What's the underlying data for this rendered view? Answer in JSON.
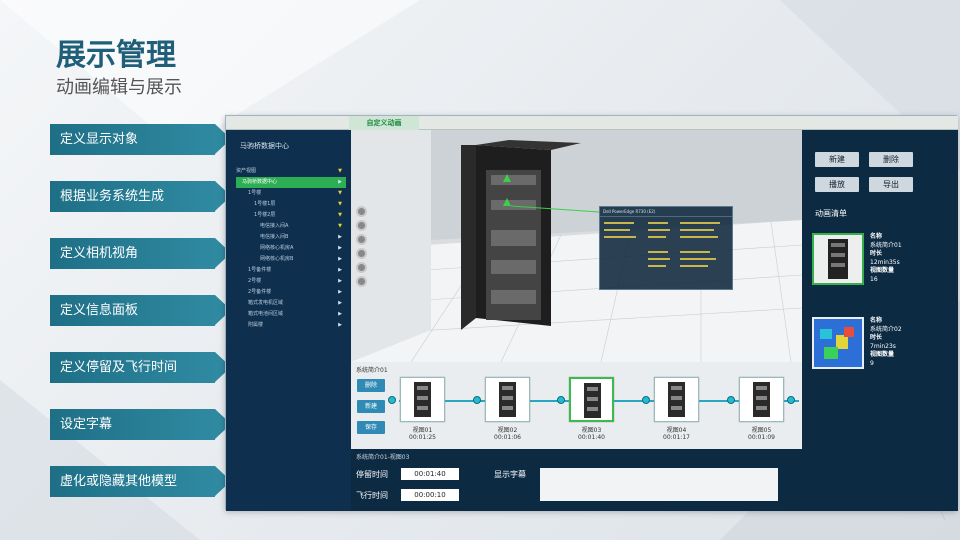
{
  "page": {
    "title": "展示管理",
    "subtitle": "动画编辑与展示"
  },
  "steps": [
    {
      "label": "定义显示对象"
    },
    {
      "label": "根据业务系统生成"
    },
    {
      "label": "定义相机视角"
    },
    {
      "label": "定义信息面板"
    },
    {
      "label": "定义停留及飞行时间"
    },
    {
      "label": "设定字幕"
    },
    {
      "label": "虚化或隐藏其他模型"
    }
  ],
  "app": {
    "active_tab": "自定义动画",
    "sidebar": {
      "header": "马驹桥数据中心",
      "tree": [
        {
          "label": "资产视图",
          "indent": 0,
          "state": "yellow"
        },
        {
          "label": "马驹桥数据中心",
          "indent": 1,
          "state": "active"
        },
        {
          "label": "1号楼",
          "indent": 2,
          "state": "yellow"
        },
        {
          "label": "1号楼1层",
          "indent": 3,
          "state": "yellow"
        },
        {
          "label": "1号楼2层",
          "indent": 3,
          "state": "yellow"
        },
        {
          "label": "电信接入间A",
          "indent": 4,
          "state": "yellow"
        },
        {
          "label": "电信接入间B",
          "indent": 4,
          "state": "normal"
        },
        {
          "label": "网络核心机房A",
          "indent": 4,
          "state": "normal"
        },
        {
          "label": "网络核心机房B",
          "indent": 4,
          "state": "normal"
        },
        {
          "label": "1号备件楼",
          "indent": 2,
          "state": "normal"
        },
        {
          "label": "2号楼",
          "indent": 2,
          "state": "normal"
        },
        {
          "label": "2号备件楼",
          "indent": 2,
          "state": "normal"
        },
        {
          "label": "箱式发电机区域",
          "indent": 2,
          "state": "normal"
        },
        {
          "label": "箱式电池间区域",
          "indent": 2,
          "state": "normal"
        },
        {
          "label": "附属楼",
          "indent": 2,
          "state": "normal"
        }
      ]
    },
    "viewport": {
      "info_panel_title": "Dell PowerEdge R730 (E2)"
    },
    "right_panel": {
      "new_label": "新建",
      "delete_label": "删除",
      "play_label": "播放",
      "export_label": "导出",
      "list_title": "动画清单",
      "animations": [
        {
          "name_label": "名称",
          "name": "系统简介01",
          "duration_label": "时长",
          "duration": "12min35s",
          "views_label": "视图数量",
          "views": "16",
          "selected": true
        },
        {
          "name_label": "名称",
          "name": "系统简介02",
          "duration_label": "时长",
          "duration": "7min23s",
          "views_label": "视图数量",
          "views": "9",
          "selected": false
        }
      ]
    },
    "timeline": {
      "title": "系统简介01",
      "delete_label": "删除",
      "new_label": "新建",
      "save_label": "保存",
      "keyframes": [
        {
          "name": "视图01",
          "time": "00:01:25",
          "selected": false
        },
        {
          "name": "视图02",
          "time": "00:01:06",
          "selected": false
        },
        {
          "name": "视图03",
          "time": "00:01:40",
          "selected": true
        },
        {
          "name": "视图04",
          "time": "00:01:17",
          "selected": false
        },
        {
          "name": "视图05",
          "time": "00:01:09",
          "selected": false
        }
      ]
    },
    "detail": {
      "title": "系统简介01-视图03",
      "stay_label": "停留时间",
      "stay_value": "00:01:40",
      "fly_label": "飞行时间",
      "fly_value": "00:00:10",
      "caption_label": "显示字幕"
    }
  },
  "colors": {
    "accent": "#1e6f86",
    "active_green": "#2eae54",
    "dark_panel": "#0d2a43"
  }
}
